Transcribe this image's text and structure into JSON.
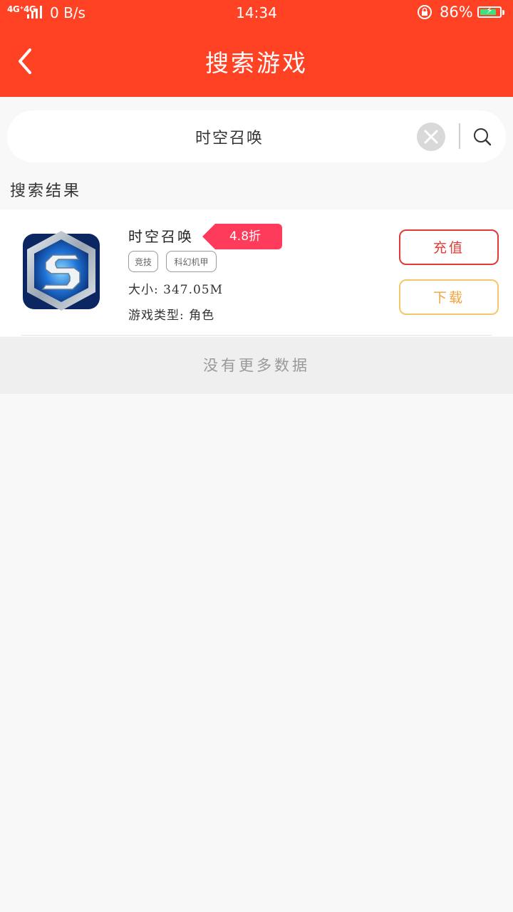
{
  "status_bar": {
    "network": "4G⁺4G",
    "speed": "0 B/s",
    "time": "14:34",
    "battery_percent": "86%",
    "battery_level": 0.86
  },
  "header": {
    "title": "搜索游戏",
    "back_icon": "chevron-left-icon"
  },
  "search": {
    "value": "时空召唤",
    "clear_icon": "close-circle-icon",
    "search_icon": "search-icon"
  },
  "section_label": "搜索结果",
  "results": [
    {
      "name": "时空召唤",
      "discount": "4.8折",
      "tags": [
        "竞技",
        "科幻机甲"
      ],
      "size": "大小: 347.05M",
      "type": "游戏类型: 角色",
      "recharge_label": "充值",
      "download_label": "下载"
    }
  ],
  "footer_text": "没有更多数据",
  "colors": {
    "primary": "#ff4124",
    "discount": "#ff3b5c",
    "recharge": "#e23a34",
    "download": "#f0a43c",
    "caret": "#ff2d6a"
  }
}
